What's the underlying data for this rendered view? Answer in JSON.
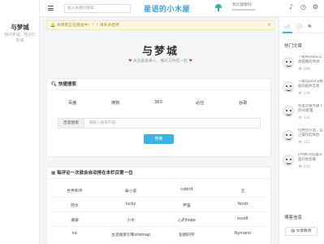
{
  "left_sidebar": {
    "title": "与梦城",
    "subtitle": "我的梦城，我记忆的城"
  },
  "topbar": {
    "search_placeholder": "输入关键词搜索…",
    "brand": "星语的小木屋",
    "player_line1": "我问题都好",
    "top_icons": [
      "music-note-icon",
      "clock-icon",
      "settings-icon"
    ]
  },
  "notice": {
    "text": "本博客正在建设中！！！请多多担待",
    "close": "×"
  },
  "header": {
    "title": "与梦城",
    "subtitle": "永远爱着某人，每天与你在一起"
  },
  "search_card": {
    "title": "快捷搜索",
    "engines": [
      "百度",
      "搜狗",
      "360",
      "必应",
      "谷歌"
    ],
    "label": "百度搜索",
    "placeholder": "请输入搜索内容",
    "button": "搜索"
  },
  "links_card": {
    "title": "每评论一次就会自动排在本栏目第一位",
    "rows": [
      [
        "世界和平",
        "泰小说",
        "cobird",
        "王"
      ],
      [
        "阿文",
        "lucky",
        "芦笛",
        "Yandr"
      ],
      [
        "姿姿",
        "小文",
        "心的hope",
        "scsoft"
      ],
      [
        "nic",
        "主流搜索引擎sitemap",
        "彭鹏同学",
        "Nymano"
      ]
    ]
  },
  "right_sidebar": {
    "hot_title": "热门文章",
    "hot_posts": [
      {
        "title": "一般Nandoc工具链路的改进",
        "views": "189"
      },
      {
        "title": "一般typecho模板的插件实现",
        "views": "149"
      },
      {
        "title": "阿里云服务器下的IIS配置",
        "views": "131"
      },
      {
        "title": "切换完毕后，自己操作的体验",
        "views": "121"
      },
      {
        "title": "js判断浏览器页面开始加载",
        "views": "118"
      }
    ],
    "info_title": "博客信息",
    "info_button": "文章数目"
  },
  "colors": {
    "accent": "#39b3e6",
    "brand": "#3aa3d8",
    "notice_bg": "#fcf7e5",
    "heart": "#dd4444"
  }
}
